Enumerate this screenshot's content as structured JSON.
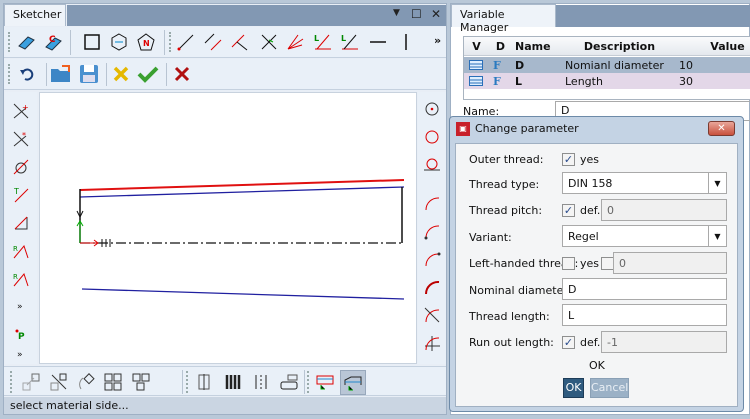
{
  "sketcher": {
    "tab_label": "Sketcher",
    "window_controls": {
      "menu": "▼",
      "maximize": "☐",
      "close": "✕"
    },
    "overflow_label": "»",
    "status_text": "select material side..."
  },
  "variable_manager": {
    "tab_label": "Variable Manager",
    "columns": [
      "V",
      "D",
      "Name",
      "Description",
      "Value"
    ],
    "rows": [
      {
        "d_icon": "F",
        "name": "D",
        "description": "Nomianl diameter",
        "value": "10"
      },
      {
        "d_icon": "F",
        "name": "L",
        "description": "Length",
        "value": "30"
      }
    ],
    "name_label": "Name:",
    "name_value": "D"
  },
  "dialog": {
    "title": "Change parameter",
    "close_label": "✕",
    "outer_thread": {
      "label": "Outer thread:",
      "checked": true,
      "check_label": "yes"
    },
    "thread_type": {
      "label": "Thread type:",
      "value": "DIN 158"
    },
    "thread_pitch": {
      "label": "Thread pitch:",
      "checked": true,
      "check_label": "def.",
      "value": "0"
    },
    "variant": {
      "label": "Variant:",
      "value": "Regel"
    },
    "left_handed": {
      "label": "Left-handed thread:",
      "checked": false,
      "check_label": "yes",
      "checked2": false,
      "value": "0"
    },
    "nominal_diameter": {
      "label": "Nominal diameter:",
      "value": "D"
    },
    "thread_length": {
      "label": "Thread length:",
      "value": "L"
    },
    "run_out_length": {
      "label": "Run out length:",
      "checked": true,
      "check_label": "def.",
      "value": "-1"
    },
    "ok_text": "OK",
    "ok_button": "OK",
    "cancel_button": "Cancel"
  },
  "colors": {
    "titlebar": "#8298b3",
    "selected_row": "#a7b8cc",
    "row2": "#e3d7e8",
    "ok_button": "#2f5b7f",
    "sketch_red": "#e01010",
    "sketch_blue": "#2020a0"
  }
}
